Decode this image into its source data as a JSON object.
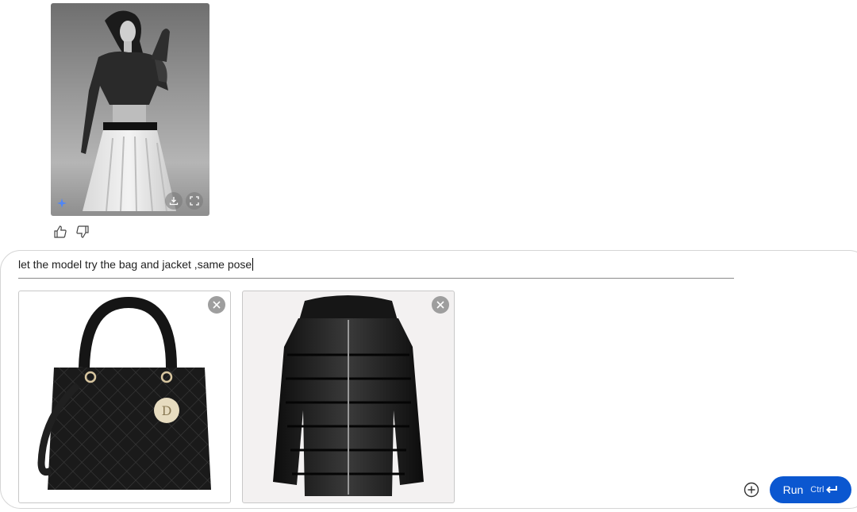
{
  "generated_image": {
    "alt": "Black and white photo of model in sequined crop jacket and white pleated skirt",
    "actions": {
      "download_icon": "download-icon",
      "fullscreen_icon": "fullscreen-icon"
    }
  },
  "feedback": {
    "thumbs_up_icon": "thumbs-up-icon",
    "thumbs_down_icon": "thumbs-down-icon"
  },
  "prompt": {
    "text": "let the model try the bag and jacket ,same pose"
  },
  "attachments": [
    {
      "name": "black quilted handbag",
      "remove_icon": "close-icon"
    },
    {
      "name": "black puffer jacket",
      "remove_icon": "close-icon"
    }
  ],
  "controls": {
    "add_icon": "add-circle-icon",
    "run_label": "Run",
    "run_shortcut": "Ctrl",
    "enter_icon": "enter-icon"
  },
  "colors": {
    "accent": "#0b57d0",
    "border": "#d5d5d5"
  }
}
